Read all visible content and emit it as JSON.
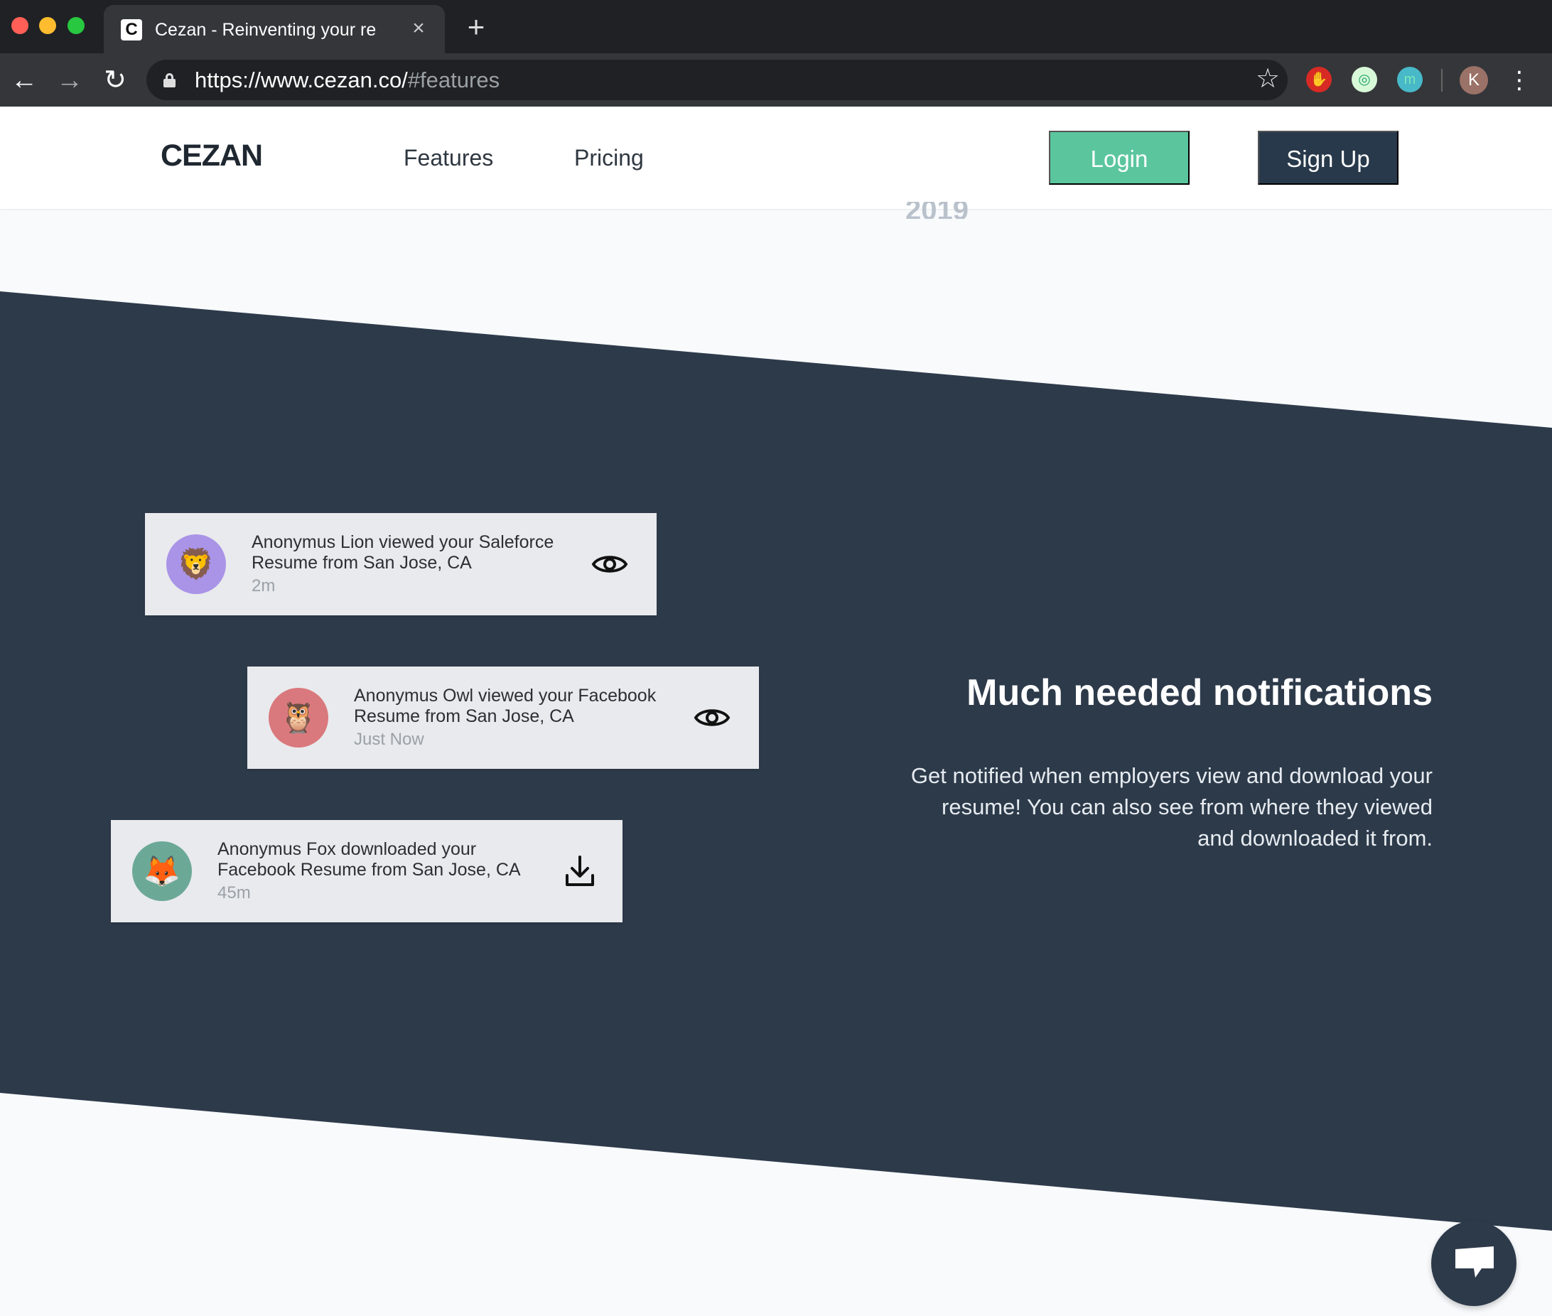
{
  "browser": {
    "tab_title": "Cezan - Reinventing your resume",
    "tab_favicon": "C",
    "tab_close": "×",
    "new_tab": "+",
    "url_host": "https://www.cezan.co/",
    "url_path": "#features",
    "profile_initial": "K",
    "extensions": [
      "hand-stop-extension-icon",
      "target-extension-icon",
      "m-extension-icon"
    ],
    "extension_m": "m"
  },
  "site": {
    "brand": "CEZAN",
    "nav": {
      "features": "Features",
      "pricing": "Pricing"
    },
    "buttons": {
      "login": "Login",
      "signup": "Sign Up"
    },
    "ghost_year": "2019"
  },
  "notifications": [
    {
      "avatar_icon": "lion-icon",
      "avatar_glyph": "🦁",
      "message": "Anonymus Lion viewed your Saleforce Resume from San Jose, CA",
      "time": "2m",
      "action_icon": "eye-icon"
    },
    {
      "avatar_icon": "owl-icon",
      "avatar_glyph": "🦉",
      "message": "Anonymus Owl viewed your Facebook Resume from San Jose, CA",
      "time": "Just Now",
      "action_icon": "eye-icon"
    },
    {
      "avatar_icon": "fox-icon",
      "avatar_glyph": "🦊",
      "message": "Anonymus Fox downloaded your Facebook Resume from San Jose, CA",
      "time": "45m",
      "action_icon": "download-icon"
    }
  ],
  "feature": {
    "title": "Much needed notifications",
    "description": "Get notified when employers view and download your resume! You can also see from where they viewed and downloaded it from."
  },
  "colors": {
    "dark_band": "#2d3a4a",
    "login": "#5bc69e",
    "signup": "#28394b",
    "lion_avatar": "#a994e7",
    "owl_avatar": "#d9797d",
    "fox_avatar": "#6ba996"
  }
}
